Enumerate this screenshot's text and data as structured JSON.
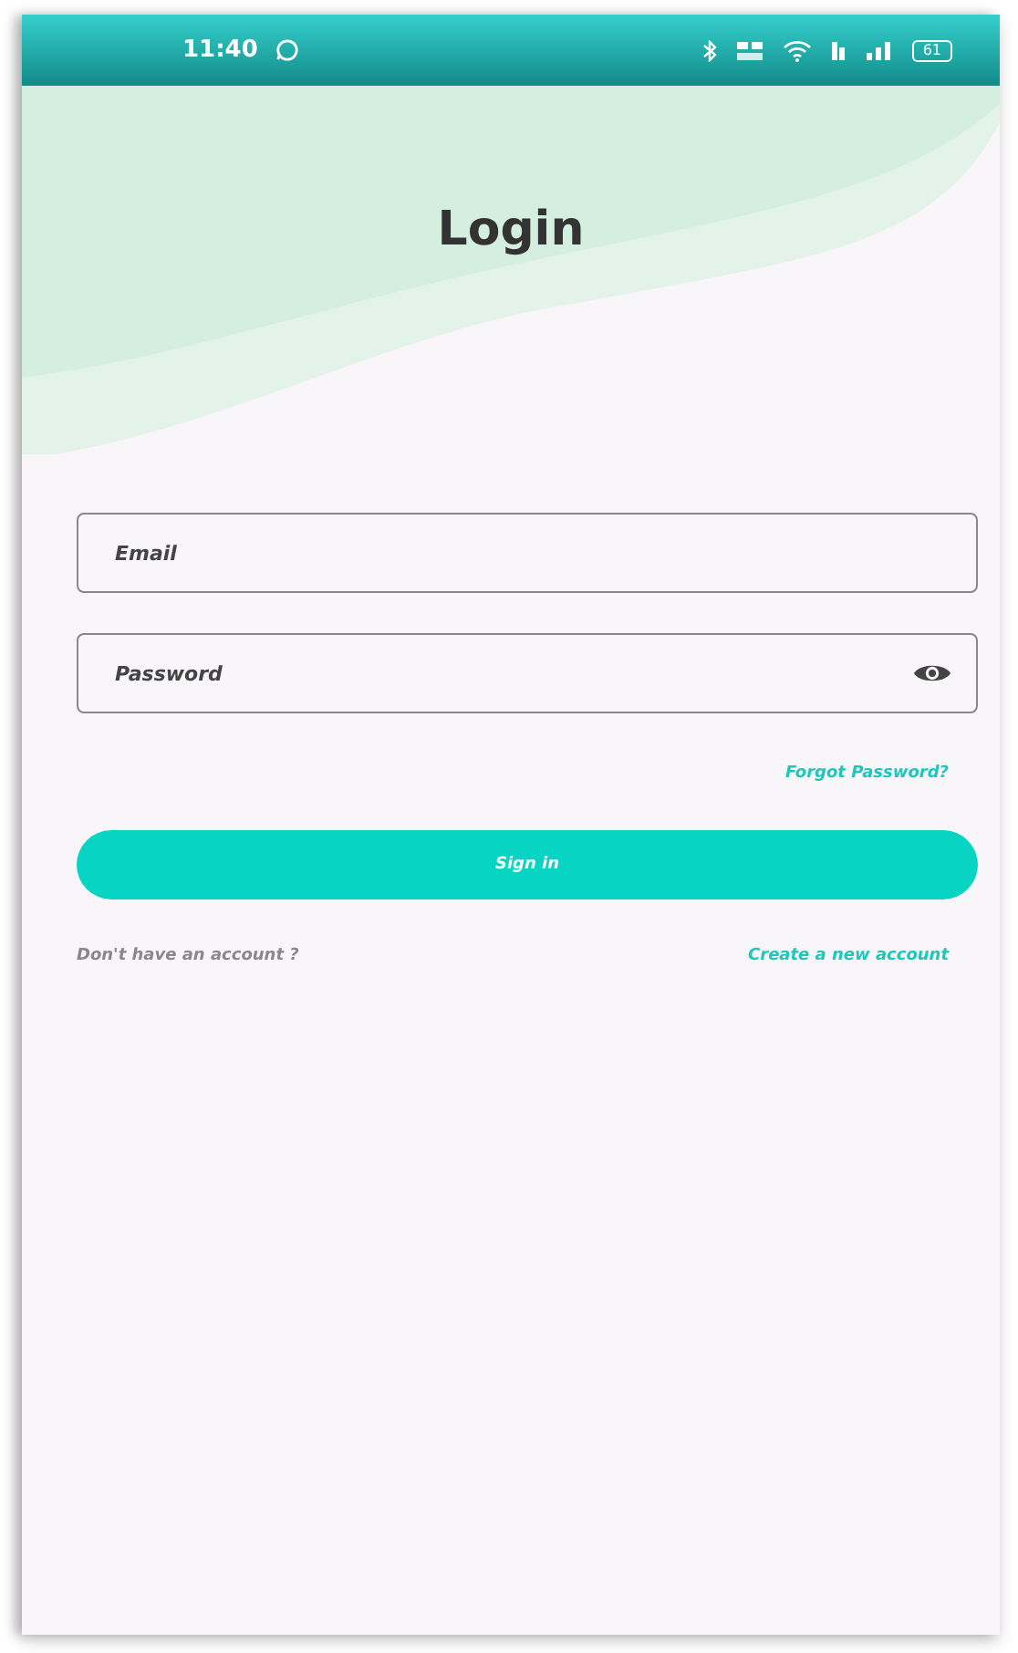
{
  "status_bar": {
    "time": "11:40",
    "battery": "61"
  },
  "title": "Login",
  "fields": [
    {
      "placeholder": "Email",
      "kind": "text"
    },
    {
      "placeholder": "Password",
      "kind": "password"
    }
  ],
  "forgot_link": "Forgot Password?",
  "sign_in_button": "Sign in",
  "signup_prompt": "Don't have an account ?",
  "signup_link": "Create a new account"
}
